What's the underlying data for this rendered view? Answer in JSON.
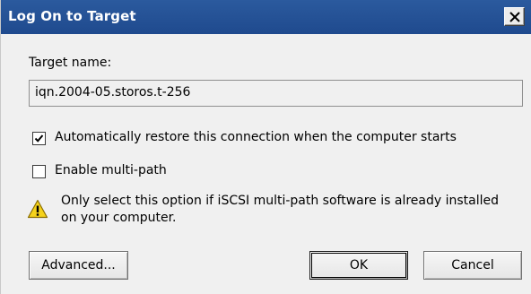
{
  "dialog": {
    "title": "Log On to Target",
    "close_glyph": "X"
  },
  "target": {
    "label": "Target name:",
    "value": "iqn.2004-05.storos.t-256"
  },
  "options": {
    "auto_restore": {
      "label": "Automatically restore this connection when the computer starts",
      "checked": true
    },
    "multipath": {
      "label": "Enable multi-path",
      "checked": false
    },
    "warning_line1": "Only select this option if iSCSI multi-path software is already installed",
    "warning_line2": "on your computer."
  },
  "buttons": {
    "advanced": "Advanced...",
    "ok": "OK",
    "cancel": "Cancel"
  },
  "icons": {
    "close": "close-icon",
    "checkmark": "checkmark-icon",
    "warning": "warning-icon"
  },
  "colors": {
    "titlebar": "#2b5a9e",
    "dialog_bg": "#f0f0f0",
    "warning_yellow": "#f5d21b"
  }
}
